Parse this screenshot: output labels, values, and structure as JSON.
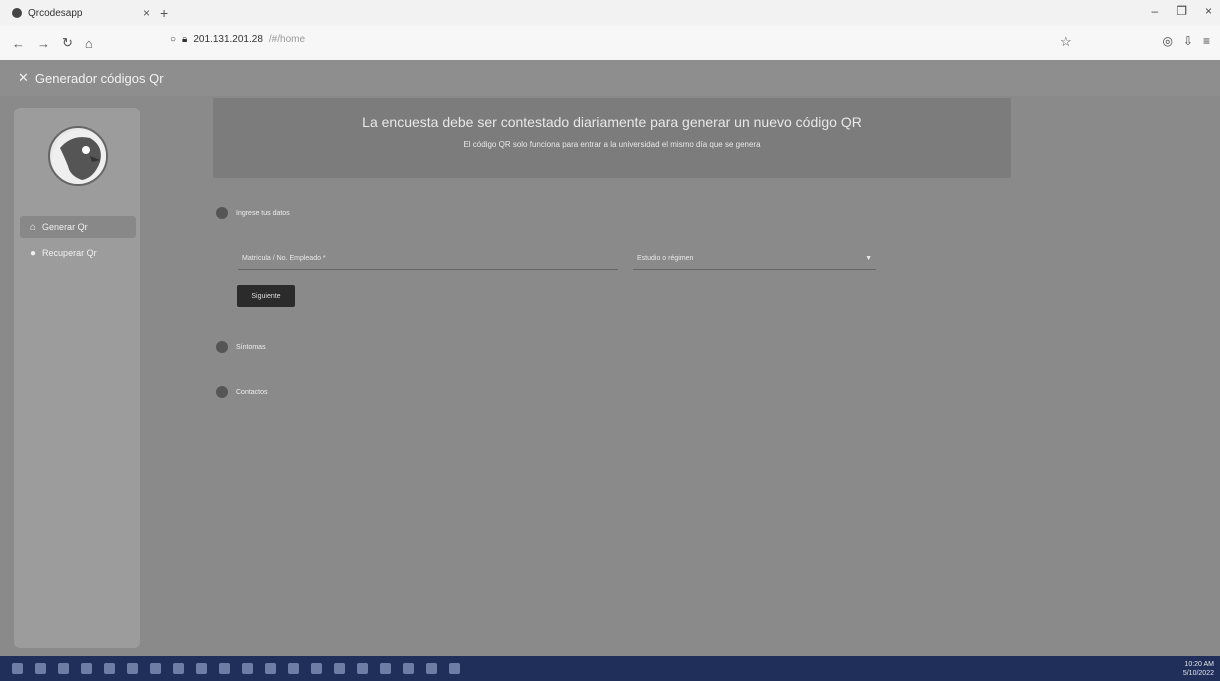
{
  "browser": {
    "tab_title": "Qrcodesapp",
    "address": "201.131.201.28",
    "address_path": "/#/home"
  },
  "app": {
    "toolbar_title": "Generador códigos Qr"
  },
  "sidebar": {
    "items": [
      {
        "label": "Generar Qr"
      },
      {
        "label": "Recuperar Qr"
      }
    ]
  },
  "banner": {
    "title": "La encuesta debe ser contestado diariamente para generar un nuevo código QR",
    "subtitle": "El código QR solo funciona para entrar a la universidad el mismo día que se genera"
  },
  "steps": [
    {
      "label": "Ingrese tus datos"
    },
    {
      "label": "Síntomas"
    },
    {
      "label": "Contactos"
    }
  ],
  "form": {
    "field1_placeholder": "Matrícula / No. Empleado *",
    "field2_placeholder": "Estudio o régimen",
    "next_label": "Siguiente"
  },
  "taskbar": {
    "time": "10:20 AM",
    "date": "5/10/2022"
  }
}
